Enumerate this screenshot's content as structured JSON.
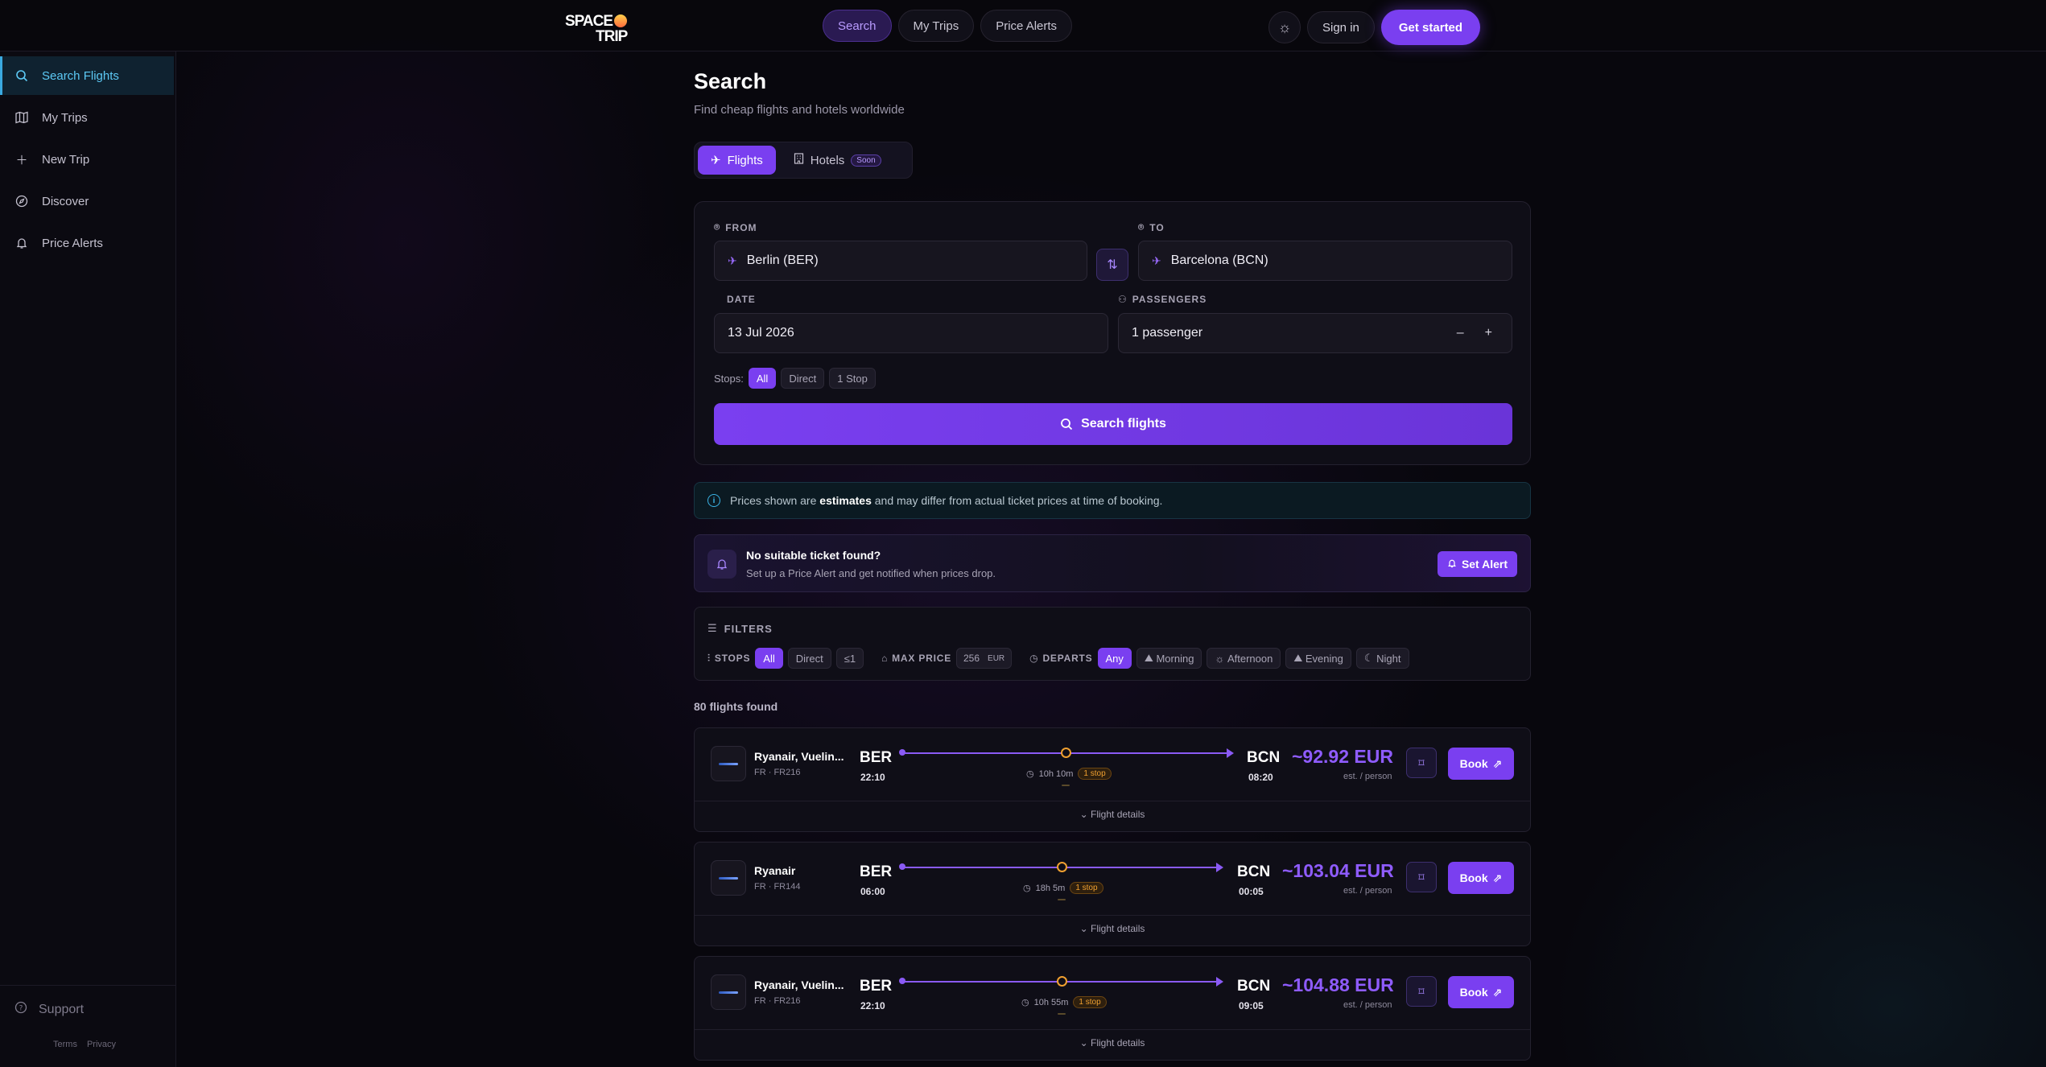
{
  "header": {
    "logo_top": "SPACE",
    "logo_bottom": "TRIP",
    "nav": [
      {
        "label": "Search",
        "active": true
      },
      {
        "label": "My Trips",
        "active": false
      },
      {
        "label": "Price Alerts",
        "active": false
      }
    ],
    "theme_icon": "sun-icon",
    "sign_in": "Sign in",
    "get_started": "Get started"
  },
  "sidebar": {
    "items": [
      {
        "label": "Search Flights",
        "icon": "search-icon",
        "active": true
      },
      {
        "label": "My Trips",
        "icon": "map-icon",
        "active": false
      },
      {
        "label": "New Trip",
        "icon": "plus-icon",
        "active": false
      },
      {
        "label": "Discover",
        "icon": "compass-icon",
        "active": false
      },
      {
        "label": "Price Alerts",
        "icon": "bell-icon",
        "active": false
      }
    ],
    "support": "Support",
    "terms": "Terms",
    "privacy": "Privacy"
  },
  "page": {
    "title": "Search",
    "subtitle": "Find cheap flights and hotels worldwide"
  },
  "mode_tabs": {
    "flights": "Flights",
    "hotels": "Hotels",
    "soon": "Soon"
  },
  "search_form": {
    "from_label": "FROM",
    "from_value": "Berlin (BER)",
    "to_label": "TO",
    "to_value": "Barcelona (BCN)",
    "date_label": "DATE",
    "date_value": "13 Jul 2026",
    "passengers_label": "PASSENGERS",
    "passengers_value": "1 passenger",
    "minus": "–",
    "plus": "+",
    "stops_label": "Stops:",
    "stops_options": [
      "All",
      "Direct",
      "1 Stop"
    ],
    "search_button": "Search flights"
  },
  "info": {
    "text_before": "Prices shown are ",
    "text_bold": "estimates",
    "text_after": " and may differ from actual ticket prices at time of booking."
  },
  "alert_card": {
    "title": "No suitable ticket found?",
    "subtitle": "Set up a Price Alert and get notified when prices drop.",
    "button": "Set Alert"
  },
  "filters": {
    "title": "FILTERS",
    "stops_label": "STOPS",
    "stops_options": [
      "All",
      "Direct",
      "≤1"
    ],
    "max_price_label": "MAX PRICE",
    "max_price_value": "256",
    "max_price_currency": "EUR",
    "departs_label": "DEPARTS",
    "departs_options": [
      "Any",
      "Morning",
      "Afternoon",
      "Evening",
      "Night"
    ]
  },
  "results": {
    "count_text": "80 flights found",
    "flights": [
      {
        "airline": "Ryanair, Vuelin...",
        "flight_no": "FR · FR216",
        "from_code": "BER",
        "from_time": "22:10",
        "to_code": "BCN",
        "to_time": "08:20",
        "duration": "10h 10m",
        "stops": "1 stop",
        "price": "~92.92 EUR",
        "price_note": "est. / person",
        "book": "Book",
        "details": "Flight details"
      },
      {
        "airline": "Ryanair",
        "flight_no": "FR · FR144",
        "from_code": "BER",
        "from_time": "06:00",
        "to_code": "BCN",
        "to_time": "00:05",
        "duration": "18h 5m",
        "stops": "1 stop",
        "price": "~103.04 EUR",
        "price_note": "est. / person",
        "book": "Book",
        "details": "Flight details"
      },
      {
        "airline": "Ryanair, Vuelin...",
        "flight_no": "FR · FR216",
        "from_code": "BER",
        "from_time": "22:10",
        "to_code": "BCN",
        "to_time": "09:05",
        "duration": "10h 55m",
        "stops": "1 stop",
        "price": "~104.88 EUR",
        "price_note": "est. / person",
        "book": "Book",
        "details": "Flight details"
      }
    ]
  },
  "colors": {
    "accent": "#7a3ff0",
    "sidebar_active": "#5cc9f5",
    "stop_orange": "#f0a030",
    "background": "#08070d"
  }
}
